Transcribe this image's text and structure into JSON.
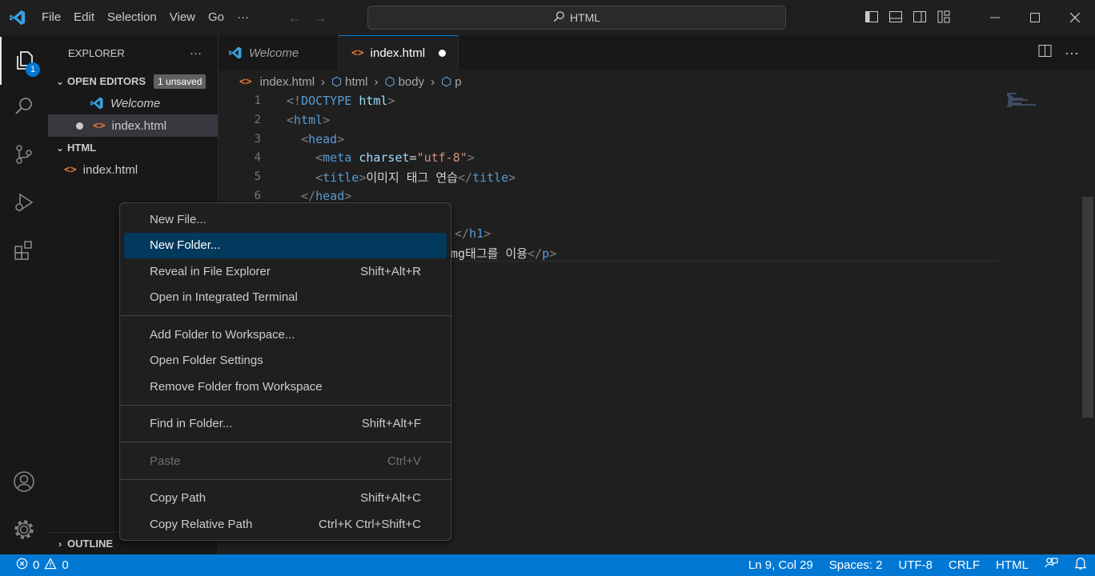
{
  "titlebar": {
    "menu": [
      "File",
      "Edit",
      "Selection",
      "View",
      "Go",
      "···"
    ],
    "search": "HTML"
  },
  "activity": {
    "explorer_badge": "1"
  },
  "sidebar": {
    "title": "EXPLORER",
    "more": "···",
    "open_editors": {
      "label": "OPEN EDITORS",
      "badge": "1 unsaved",
      "items": [
        "Welcome",
        "index.html"
      ]
    },
    "folder": {
      "label": "HTML",
      "items": [
        "index.html"
      ]
    },
    "outline": "OUTLINE"
  },
  "tabs": [
    {
      "label": "Welcome"
    },
    {
      "label": "index.html"
    }
  ],
  "breadcrumb": [
    "index.html",
    "html",
    "body",
    "p"
  ],
  "editor": {
    "line_numbers": [
      "1",
      "2",
      "3",
      "4",
      "5",
      "6"
    ],
    "lines": [
      "<!DOCTYPE html>",
      "<html>",
      "<head>",
      "<meta charset=\"utf-8\">",
      "<title>이미지 태그 연습</title>",
      "</head>"
    ],
    "partial_h1_close": "</h1>",
    "partial_p_text": "mg태그를 이용",
    "partial_p_close": "</p>"
  },
  "context_menu": [
    {
      "label": "New File...",
      "key": ""
    },
    {
      "label": "New Folder...",
      "key": ""
    },
    {
      "label": "Reveal in File Explorer",
      "key": "Shift+Alt+R"
    },
    {
      "label": "Open in Integrated Terminal",
      "key": ""
    },
    {
      "label": "Add Folder to Workspace...",
      "key": ""
    },
    {
      "label": "Open Folder Settings",
      "key": ""
    },
    {
      "label": "Remove Folder from Workspace",
      "key": ""
    },
    {
      "label": "Find in Folder...",
      "key": "Shift+Alt+F"
    },
    {
      "label": "Paste",
      "key": "Ctrl+V"
    },
    {
      "label": "Copy Path",
      "key": "Shift+Alt+C"
    },
    {
      "label": "Copy Relative Path",
      "key": "Ctrl+K Ctrl+Shift+C"
    }
  ],
  "status": {
    "errors": "0",
    "warnings": "0",
    "position": "Ln 9, Col 29",
    "spaces": "Spaces: 2",
    "encoding": "UTF-8",
    "eol": "CRLF",
    "language": "HTML"
  },
  "colors": {
    "accent": "#0078d4",
    "menu_highlight": "#04395e",
    "html_icon": "#e37933"
  }
}
